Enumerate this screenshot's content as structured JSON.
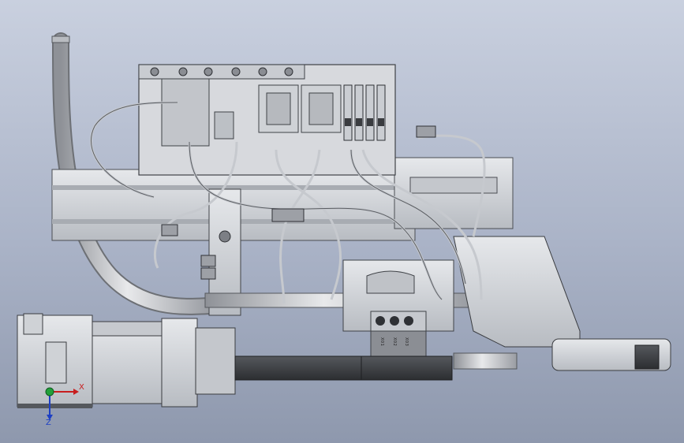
{
  "viewport": {
    "background_top": "#c9d0df",
    "background_bottom": "#8e98ad"
  },
  "model": {
    "body_color": "#d4d6da",
    "dark_part_color": "#3a3c40",
    "cable_color": "#c6c9ce"
  },
  "io_panel": {
    "labels": [
      "X01",
      "X02",
      "X03"
    ]
  },
  "triad": {
    "x_label": "X",
    "z_label": "Z",
    "x_color": "#c81e1e",
    "y_color": "#22a03a",
    "z_color": "#1d3fc4"
  }
}
